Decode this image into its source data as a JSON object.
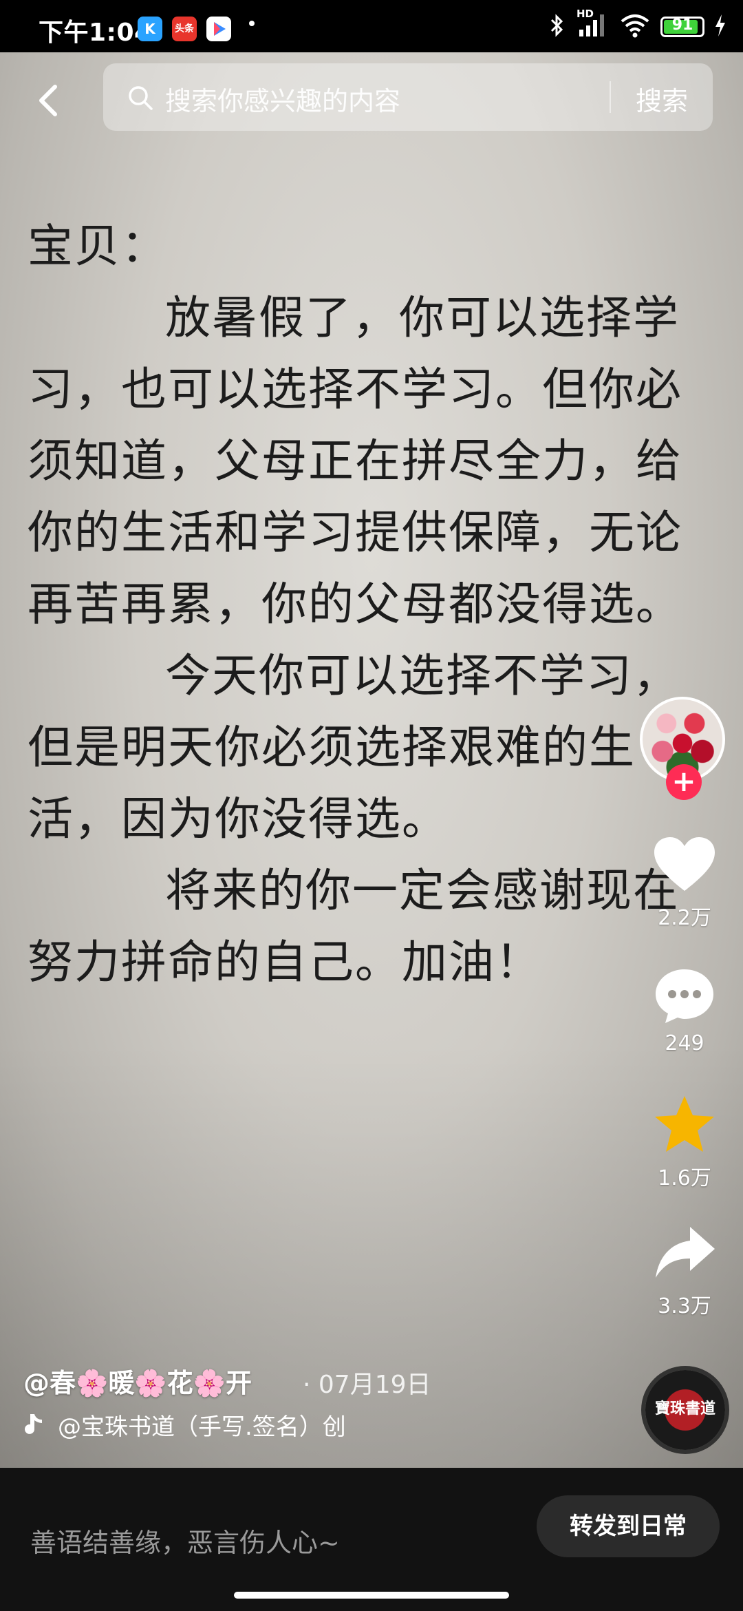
{
  "status_bar": {
    "time": "下午1:04",
    "apps": [
      {
        "name": "kuaishou-app-icon",
        "label": "K",
        "color": "#2aa3ff"
      },
      {
        "name": "toutiao-app-icon",
        "label": "头条",
        "color": "#e8352c"
      },
      {
        "name": "play-store-icon",
        "label": "▶",
        "color": "#ffffff"
      }
    ],
    "network": "HD",
    "battery_level": "91",
    "battery_fraction": 0.91
  },
  "search": {
    "placeholder": "搜索你感兴趣的内容",
    "button_label": "搜索"
  },
  "letter": {
    "greeting": "宝贝：",
    "paragraphs": [
      "放暑假了，你可以选择学习，也可以选择不学习。但你必须知道，父母正在拼尽全力，给你的生活和学习提供保障，无论再苦再累，你的父母都没得选。",
      "今天你可以选择不学习，但是明天你必须选择艰难的生活，因为你没得选。",
      "将来的你一定会感谢现在努力拼命的自己。加油！"
    ]
  },
  "rail": {
    "like_count": "2.2万",
    "comment_count": "249",
    "favorite_count": "1.6万",
    "share_count": "3.3万",
    "follow_symbol": "+"
  },
  "video_info": {
    "author": "@春🌸暖🌸花🌸开",
    "date": "· 07月19日",
    "music": "@宝珠书道（手写.签名）创",
    "disc_text": "寶珠書道"
  },
  "bottom_bar": {
    "comment_placeholder": "善语结善缘，恶言伤人心~",
    "repost_label": "转发到日常"
  },
  "colors": {
    "accent_red": "#fe2c55",
    "favorite_yellow": "#f7b500"
  }
}
